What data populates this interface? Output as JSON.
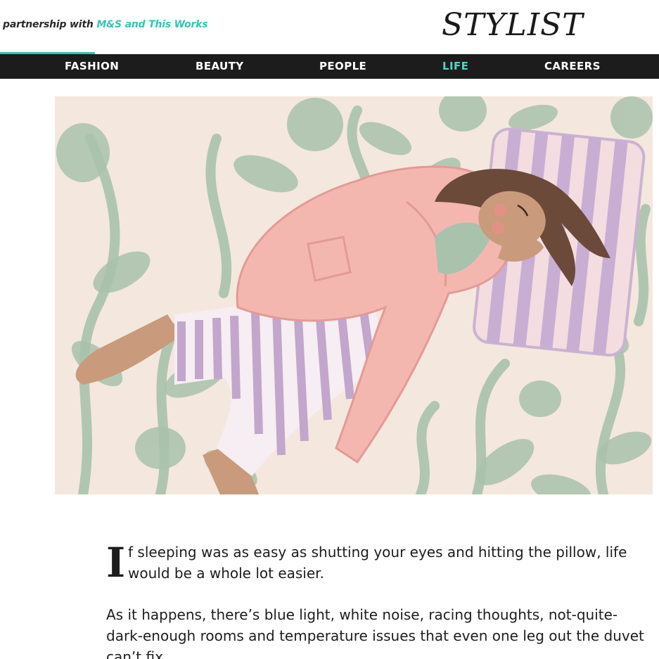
{
  "header": {
    "partner_prefix": "partnership with",
    "partner_brand": "M&S and This Works",
    "logo": "STYLIST"
  },
  "nav": {
    "items": [
      {
        "label": "FASHION",
        "active": false
      },
      {
        "label": "BEAUTY",
        "active": false
      },
      {
        "label": "PEOPLE",
        "active": false
      },
      {
        "label": "LIFE",
        "active": true
      },
      {
        "label": "CAREERS",
        "active": false
      }
    ]
  },
  "colors": {
    "accent": "#2fc7b3",
    "nav_bg": "#1c1c1c",
    "nav_active": "#4fd6c4"
  },
  "hero": {
    "icon": "sleeping-woman-illustration"
  },
  "article": {
    "dropcap": "I",
    "lead_rest": "f sleeping was as easy as shutting your eyes and hitting the pillow, life would be a whole lot easier.",
    "paragraph_2": "As it happens, there’s blue light, white noise, racing thoughts, not-quite-dark-enough rooms and temperature issues that even one leg out the duvet can’t fix."
  }
}
